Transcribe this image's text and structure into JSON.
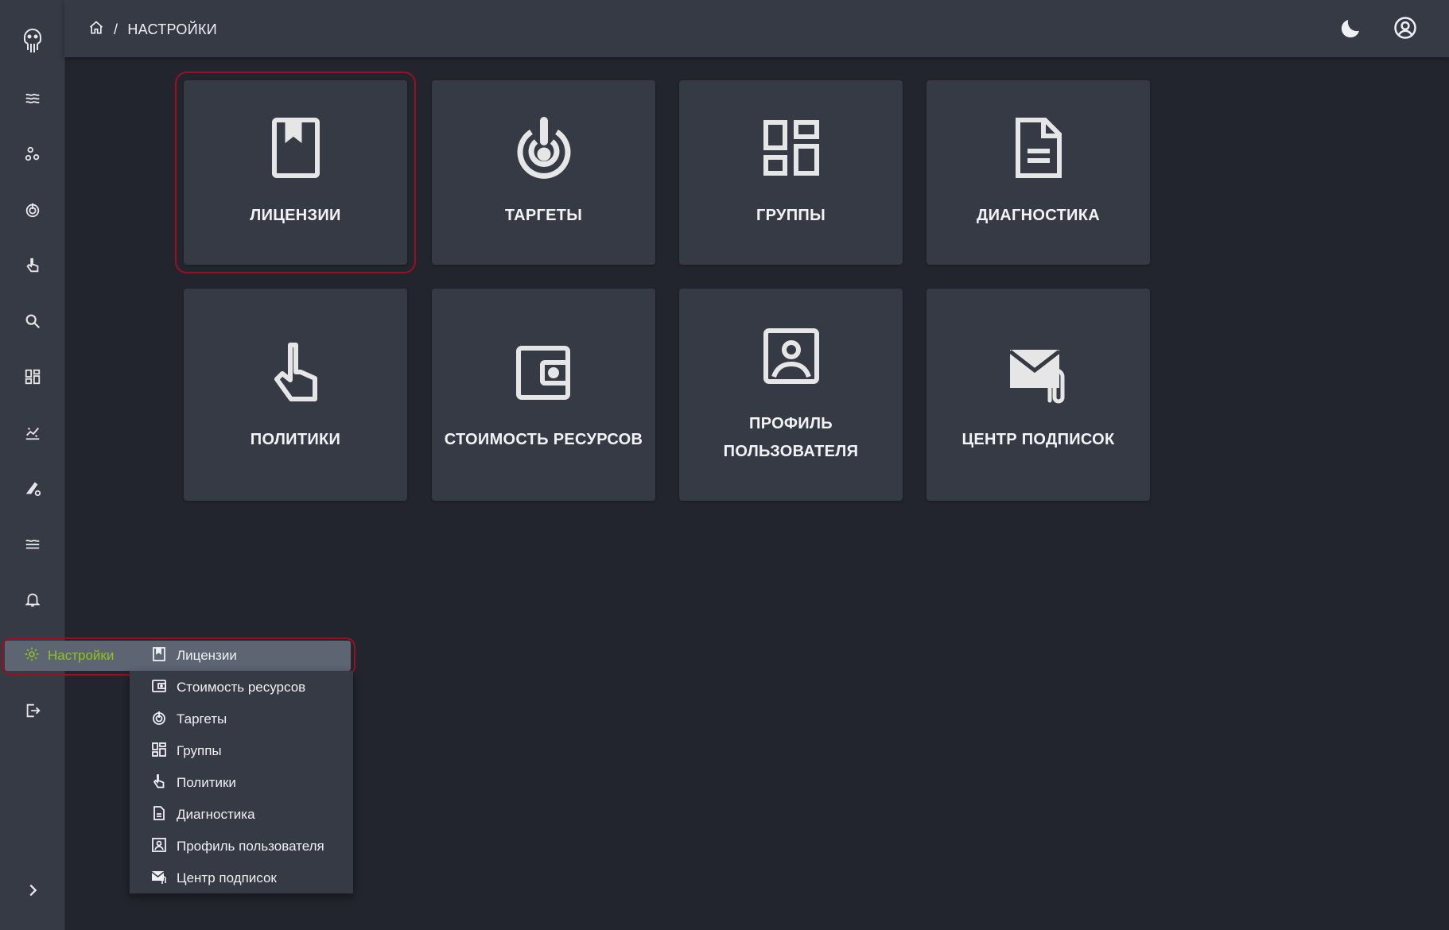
{
  "breadcrumb": {
    "current": "НАСТРОЙКИ",
    "separator": "/"
  },
  "sidebar": {
    "icons": [
      "logo-icon",
      "waves-icon",
      "cluster-icon",
      "target-icon",
      "pointer-hand-icon",
      "search-icon",
      "dashboard-icon",
      "chart-icon",
      "edit-settings-icon",
      "stream-icon",
      "bell-icon",
      "logout-icon",
      "chevron-right-icon"
    ],
    "settings_label": "Настройки"
  },
  "tiles": [
    {
      "label": "ЛИЦЕНЗИИ",
      "icon": "license-book-icon"
    },
    {
      "label": "ТАРГЕТЫ",
      "icon": "target-icon"
    },
    {
      "label": "ГРУППЫ",
      "icon": "groups-grid-icon"
    },
    {
      "label": "ДИАГНОСТИКА",
      "icon": "document-icon"
    },
    {
      "label": "ПОЛИТИКИ",
      "icon": "pointer-hand-icon"
    },
    {
      "label": "СТОИМОСТЬ РЕСУРСОВ",
      "icon": "wallet-icon"
    },
    {
      "label": "ПРОФИЛЬ ПОЛЬЗОВАТЕЛЯ",
      "icon": "profile-portrait-icon"
    },
    {
      "label": "ЦЕНТР ПОДПИСОК",
      "icon": "mail-attachment-icon"
    }
  ],
  "submenu": [
    {
      "label": "Лицензии",
      "icon": "license-book-icon"
    },
    {
      "label": "Стоимость ресурсов",
      "icon": "wallet-icon"
    },
    {
      "label": "Таргеты",
      "icon": "target-icon"
    },
    {
      "label": "Группы",
      "icon": "groups-grid-icon"
    },
    {
      "label": "Политики",
      "icon": "pointer-hand-icon"
    },
    {
      "label": "Диагностика",
      "icon": "document-icon"
    },
    {
      "label": "Профиль пользователя",
      "icon": "profile-portrait-icon"
    },
    {
      "label": "Центр подписок",
      "icon": "mail-attachment-icon"
    }
  ],
  "colors": {
    "background": "#22252e",
    "panel": "#353a45",
    "accent_green": "#8fc31f",
    "highlight_red": "#9b1020"
  }
}
